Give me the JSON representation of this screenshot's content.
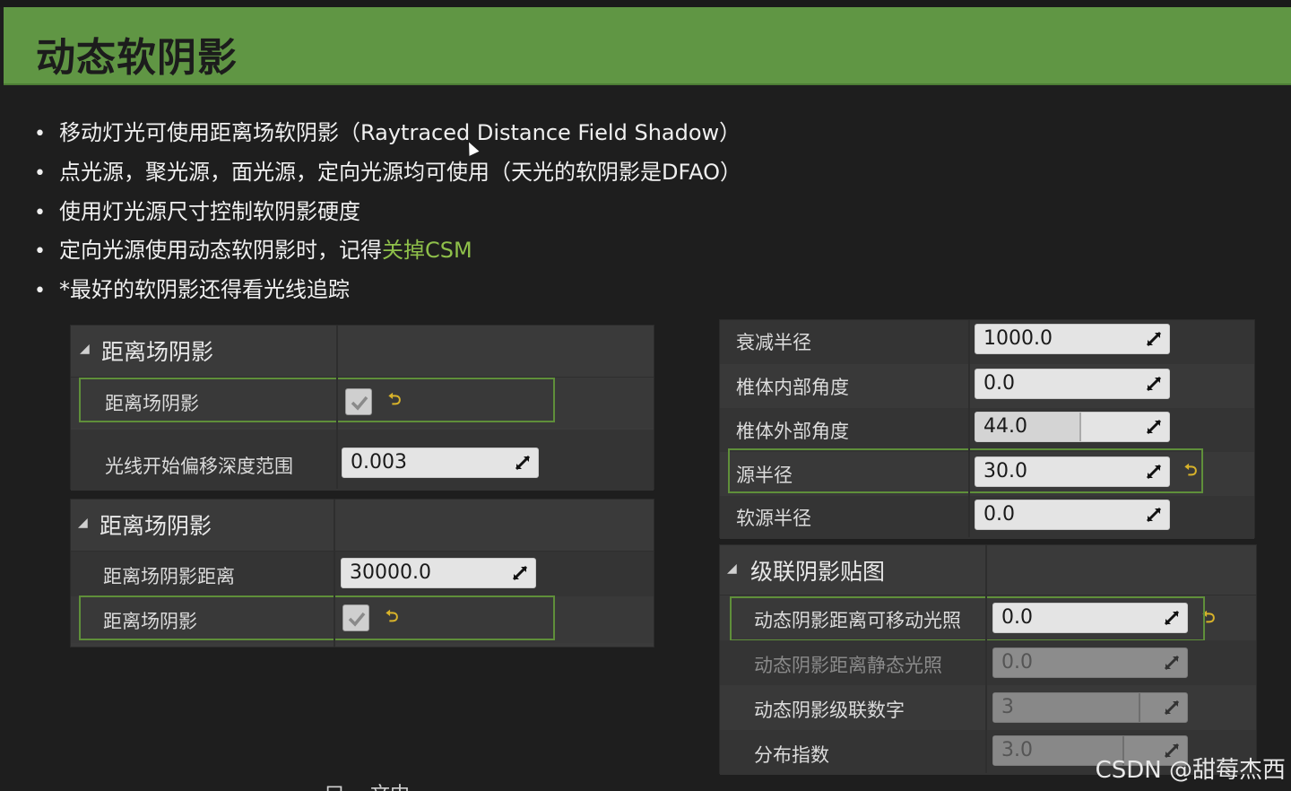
{
  "slide": {
    "title": "动态软阴影",
    "bullets": [
      {
        "text": "移动灯光可使用距离场软阴影（Raytraced Distance Field Shadow）",
        "highlight": ""
      },
      {
        "text": "点光源，聚光源，面光源，定向光源均可使用（天光的软阴影是DFAO）",
        "highlight": ""
      },
      {
        "text": "使用灯光源尺寸控制软阴影硬度",
        "highlight": ""
      },
      {
        "text": "定向光源使用动态软阴影时，记得",
        "highlight": "关掉CSM"
      },
      {
        "text": "*最好的软阴影还得看光线追踪",
        "highlight": ""
      }
    ],
    "bullet_symbol": "•",
    "accent_color": "#609644",
    "highlight_color": "#8fc04a",
    "watermark": "CSDN @甜莓杰西",
    "bottom_text": "…口 …文中…"
  },
  "panel1": {
    "header": "距离场阴影",
    "checkbox_label": "距离场阴影",
    "checkbox_checked": true,
    "offset_label": "光线开始偏移深度范围",
    "offset_value": "0.003"
  },
  "panel2": {
    "header": "距离场阴影",
    "distance_label": "距离场阴影距离",
    "distance_value": "30000.0",
    "checkbox_label": "距离场阴影",
    "checkbox_checked": true
  },
  "panel3": {
    "rows": [
      {
        "label": "衰减半径",
        "value": "1000.0"
      },
      {
        "label": "椎体内部角度",
        "value": "0.0"
      },
      {
        "label": "椎体外部角度",
        "value": "44.0"
      },
      {
        "label": "源半径",
        "value": "30.0"
      },
      {
        "label": "软源半径",
        "value": "0.0"
      }
    ]
  },
  "panel4": {
    "header": "级联阴影贴图",
    "rows": [
      {
        "label": "动态阴影距离可移动光照",
        "value": "0.0"
      },
      {
        "label": "动态阴影距离静态光照",
        "value": "0.0"
      },
      {
        "label": "动态阴影级联数字",
        "value": "3"
      },
      {
        "label": "分布指数",
        "value": "3.0"
      }
    ]
  },
  "icons": {
    "expand": "triangle-down-icon",
    "spinner": "drag-arrows-icon",
    "reset": "reset-to-default-icon",
    "check": "checkmark-icon"
  }
}
